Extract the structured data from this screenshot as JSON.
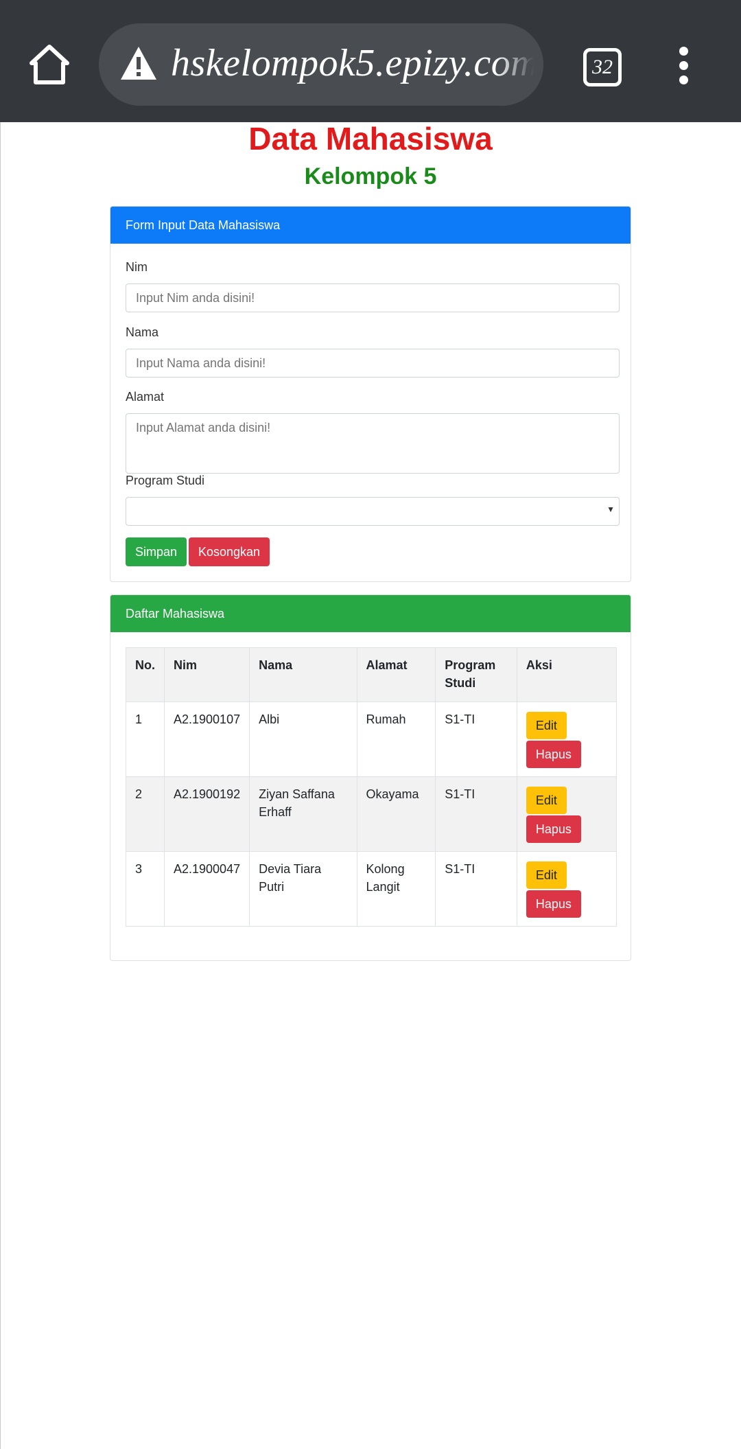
{
  "browser": {
    "url": "hskelompok5.epizy.com",
    "tab_count": "32"
  },
  "page": {
    "title": "Data Mahasiswa",
    "subtitle": "Kelompok 5"
  },
  "form": {
    "header": "Form Input Data Mahasiswa",
    "nim_label": "Nim",
    "nim_placeholder": "Input Nim anda disini!",
    "nama_label": "Nama",
    "nama_placeholder": "Input Nama anda disini!",
    "alamat_label": "Alamat",
    "alamat_placeholder": "Input Alamat anda disini!",
    "prodi_label": "Program Studi",
    "prodi_value": "",
    "save_label": "Simpan",
    "clear_label": "Kosongkan"
  },
  "list": {
    "header": "Daftar Mahasiswa",
    "columns": [
      "No.",
      "Nim",
      "Nama",
      "Alamat",
      "Program Studi",
      "Aksi"
    ],
    "rows": [
      {
        "no": "1",
        "nim": "A2.1900107",
        "nama": "Albi",
        "alamat": "Rumah",
        "prodi": "S1-TI"
      },
      {
        "no": "2",
        "nim": "A2.1900192",
        "nama": "Ziyan Saffana Erhaff",
        "alamat": "Okayama",
        "prodi": "S1-TI"
      },
      {
        "no": "3",
        "nim": "A2.1900047",
        "nama": "Devia Tiara Putri",
        "alamat": "Kolong Langit",
        "prodi": "S1-TI"
      }
    ],
    "edit_label": "Edit",
    "delete_label": "Hapus"
  },
  "colors": {
    "topbar": "#34373b",
    "title": "#e11b1b",
    "subtitle": "#1a8a1a",
    "primary": "#0d7bf7",
    "success": "#28a745",
    "danger": "#dc3545",
    "warning": "#ffc107"
  },
  "icons": {
    "home": "home-icon",
    "warning": "warning-icon",
    "menu": "more-vert-icon"
  }
}
